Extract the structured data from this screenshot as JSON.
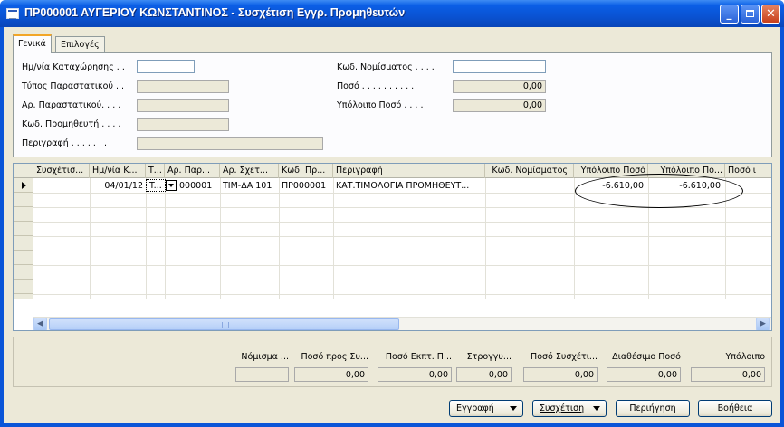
{
  "window": {
    "title": "ΠΡ000001 ΑΥΓΕΡΙΟΥ ΚΩΝΣΤΑΝΤΙΝΟΣ - Συσχέτιση Εγγρ. Προμηθευτών"
  },
  "tabs": [
    {
      "label": "Γενικά",
      "active": true
    },
    {
      "label": "Επιλογές",
      "active": false
    }
  ],
  "form": {
    "left": [
      {
        "label": "Ημ/νία Καταχώρησης  . .",
        "value": ""
      },
      {
        "label": "Τύπος Παραστατικού  . .",
        "value": ""
      },
      {
        "label": "Αρ. Παραστατικού. . . .",
        "value": ""
      },
      {
        "label": "Κωδ. Προμηθευτή . . . .",
        "value": ""
      },
      {
        "label": "Περιγραφή . . . . . . .",
        "value": ""
      }
    ],
    "right": [
      {
        "label": "Κωδ. Νομίσματος . . . .",
        "value": ""
      },
      {
        "label": "Ποσό . . . . . . . . . .",
        "value": "0,00"
      },
      {
        "label": "Υπόλοιπο Ποσό  . . . .",
        "value": "0,00"
      }
    ]
  },
  "grid": {
    "columns": [
      "Συσχέτισ...",
      "Ημ/νία Κ...",
      "Τ...",
      "Αρ. Παρ...",
      "Αρ. Σχετ...",
      "Κωδ. Πρ...",
      "Περιγραφή",
      "Κωδ. Νομίσματος",
      "Υπόλοιπο Ποσό",
      "Υπόλοιπο Πο...",
      "Ποσό ι"
    ],
    "rows": [
      [
        "",
        "04/01/12",
        "T...",
        "000001",
        "ΤΙΜ-ΔΑ 101",
        "ΠΡ000001",
        "ΚΑΤ.ΤΙΜΟΛΟΓΙΑ ΠΡΟΜΗΘΕΥΤ...",
        "",
        "-6.610,00",
        "-6.610,00",
        ""
      ]
    ]
  },
  "totals": [
    {
      "label": "Νόμισμα ...",
      "value": ""
    },
    {
      "label": "Ποσό προς Συ...",
      "value": "0,00"
    },
    {
      "label": "Ποσό Εκπτ. Π...",
      "value": "0,00"
    },
    {
      "label": "Στρογγυ...",
      "value": "0,00"
    },
    {
      "label": "Ποσό Συσχέτι...",
      "value": "0,00"
    },
    {
      "label": "Διαθέσιμο Ποσό",
      "value": "0,00"
    },
    {
      "label": "Υπόλοιπο",
      "value": "0,00"
    }
  ],
  "buttons": {
    "register": "Εγγραφή",
    "relate": "Συσχέτιση",
    "navigate": "Περιήγηση",
    "help": "Βοήθεια"
  },
  "icons": {
    "window_icon": "form-icon",
    "minimize": "minimize-icon",
    "maximize": "maximize-icon",
    "close": "close-icon"
  }
}
